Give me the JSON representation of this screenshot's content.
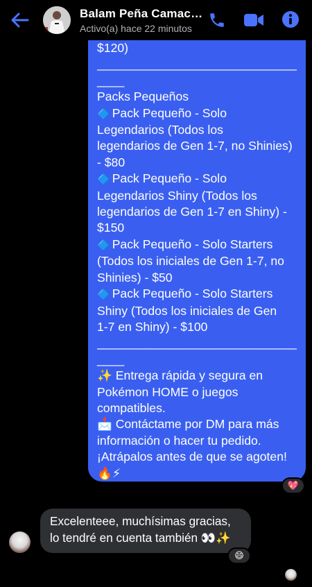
{
  "header": {
    "contact_name": "Balam Peña Camacho",
    "status": "Activo(a) hace 22 minutos"
  },
  "outgoing_message": {
    "top_fragment": "$120)",
    "rule": "________________________________",
    "rule_tail": "____",
    "section_title": "Packs Pequeños",
    "items": [
      [
        "Pack Pequeño - Solo",
        "Legendarios (Todos los",
        "legendarios de Gen 1-7, no Shinies)",
        "- $80"
      ],
      [
        "Pack Pequeño - Solo",
        "Legendarios Shiny (Todos los",
        "legendarios de Gen 1-7 en Shiny) -",
        "$150"
      ],
      [
        "Pack Pequeño - Solo Starters",
        "(Todos los iniciales de Gen 1-7, no",
        "Shinies) - $50"
      ],
      [
        "Pack Pequeño - Solo Starters",
        "Shiny (Todos los iniciales de Gen",
        "1-7 en Shiny) - $100"
      ]
    ],
    "rule2": "________________________________",
    "rule2_tail": "____",
    "footer_lines": [
      "✨ Entrega rápida y segura en",
      "Pokémon HOME o juegos",
      "compatibles.",
      "📩 Contáctame por DM para más",
      "información o hacer tu pedido.",
      "¡Atrápalos antes de que se agoten!",
      "🔥⚡"
    ],
    "reaction": "💖"
  },
  "incoming_message": {
    "lines": [
      "Excelenteee, muchísimas gracias,",
      "lo tendré en cuenta también 👀✨"
    ],
    "reaction": "😄"
  },
  "colors": {
    "accent": "#3a5ff0",
    "icon_blue": "#4a73ff",
    "incoming_bubble": "#2f3033",
    "background": "#000000"
  },
  "icons": {
    "back": "back-arrow-icon",
    "call": "phone-icon",
    "video": "video-camera-icon",
    "info": "info-icon"
  }
}
